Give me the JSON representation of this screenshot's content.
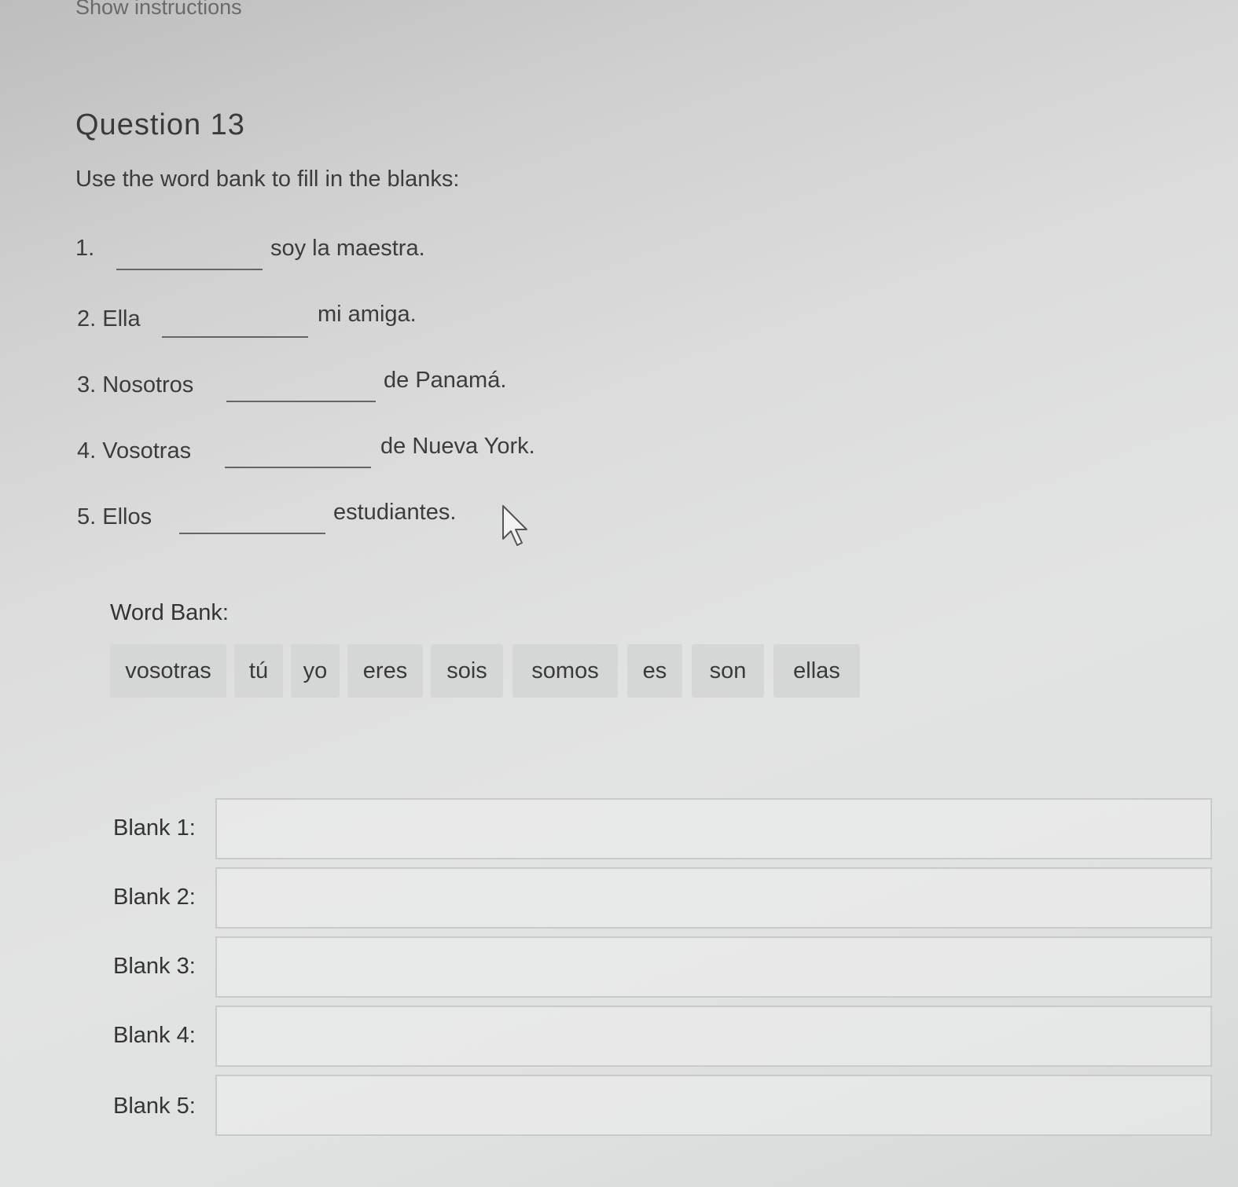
{
  "show_instructions": "Show instructions",
  "question": {
    "title": "Question 13",
    "instruction": "Use the word bank to fill in the blanks:"
  },
  "items": [
    {
      "prefix": "1.",
      "rest": "soy la maestra."
    },
    {
      "prefix": "2. Ella",
      "rest": "mi amiga."
    },
    {
      "prefix": "3. Nosotros",
      "rest": "de Panamá."
    },
    {
      "prefix": "4. Vosotras",
      "rest": "de Nueva York."
    },
    {
      "prefix": "5. Ellos",
      "rest": "estudiantes."
    }
  ],
  "word_bank": {
    "label": "Word Bank:",
    "words": [
      "vosotras",
      "tú",
      "yo",
      "eres",
      "sois",
      "somos",
      "es",
      "son",
      "ellas"
    ]
  },
  "blanks": [
    {
      "label": "Blank 1:",
      "value": ""
    },
    {
      "label": "Blank 2:",
      "value": ""
    },
    {
      "label": "Blank 3:",
      "value": ""
    },
    {
      "label": "Blank 4:",
      "value": ""
    },
    {
      "label": "Blank 5:",
      "value": ""
    }
  ],
  "icons": {
    "cursor": "mouse-pointer-icon"
  }
}
